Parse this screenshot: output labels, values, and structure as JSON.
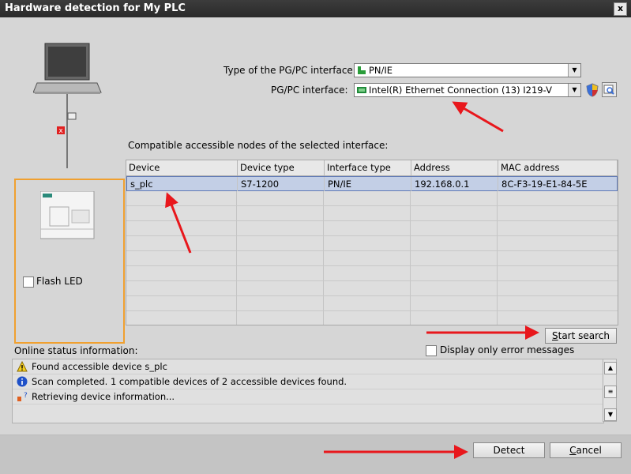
{
  "window": {
    "title": "Hardware detection for My PLC",
    "close_glyph": "x"
  },
  "interface": {
    "type_label": "Type of the PG/PC interface:",
    "type_value": "PN/IE",
    "pgpc_label": "PG/PC interface:",
    "pgpc_value": "Intel(R) Ethernet Connection (13) I219-V"
  },
  "nodes": {
    "caption": "Compatible accessible nodes of the selected interface:",
    "columns": [
      "Device",
      "Device type",
      "Interface type",
      "Address",
      "MAC address"
    ],
    "rows": [
      [
        "s_plc",
        "S7-1200",
        "PN/IE",
        "192.168.0.1",
        "8C-F3-19-E1-84-5E"
      ]
    ]
  },
  "flash_led_label": "Flash LED",
  "start_search": {
    "prefix": "",
    "mnemonic": "S",
    "rest": "tart search"
  },
  "display_errors_label": "Display only error messages",
  "status": {
    "caption": "Online status information:",
    "messages": [
      {
        "icon": "warning-icon",
        "text": "Found accessible device s_plc"
      },
      {
        "icon": "info-icon",
        "text": "Scan completed. 1 compatible devices of 2 accessible devices found."
      },
      {
        "icon": "progress-icon",
        "text": "Retrieving device information..."
      }
    ]
  },
  "footer": {
    "detect_label": "Detect",
    "cancel": {
      "mnemonic": "C",
      "rest": "ancel"
    }
  },
  "colors": {
    "annotation_arrow": "#e8171c",
    "highlight_box": "#f0a030",
    "selected_row": "#c3cfe6"
  }
}
